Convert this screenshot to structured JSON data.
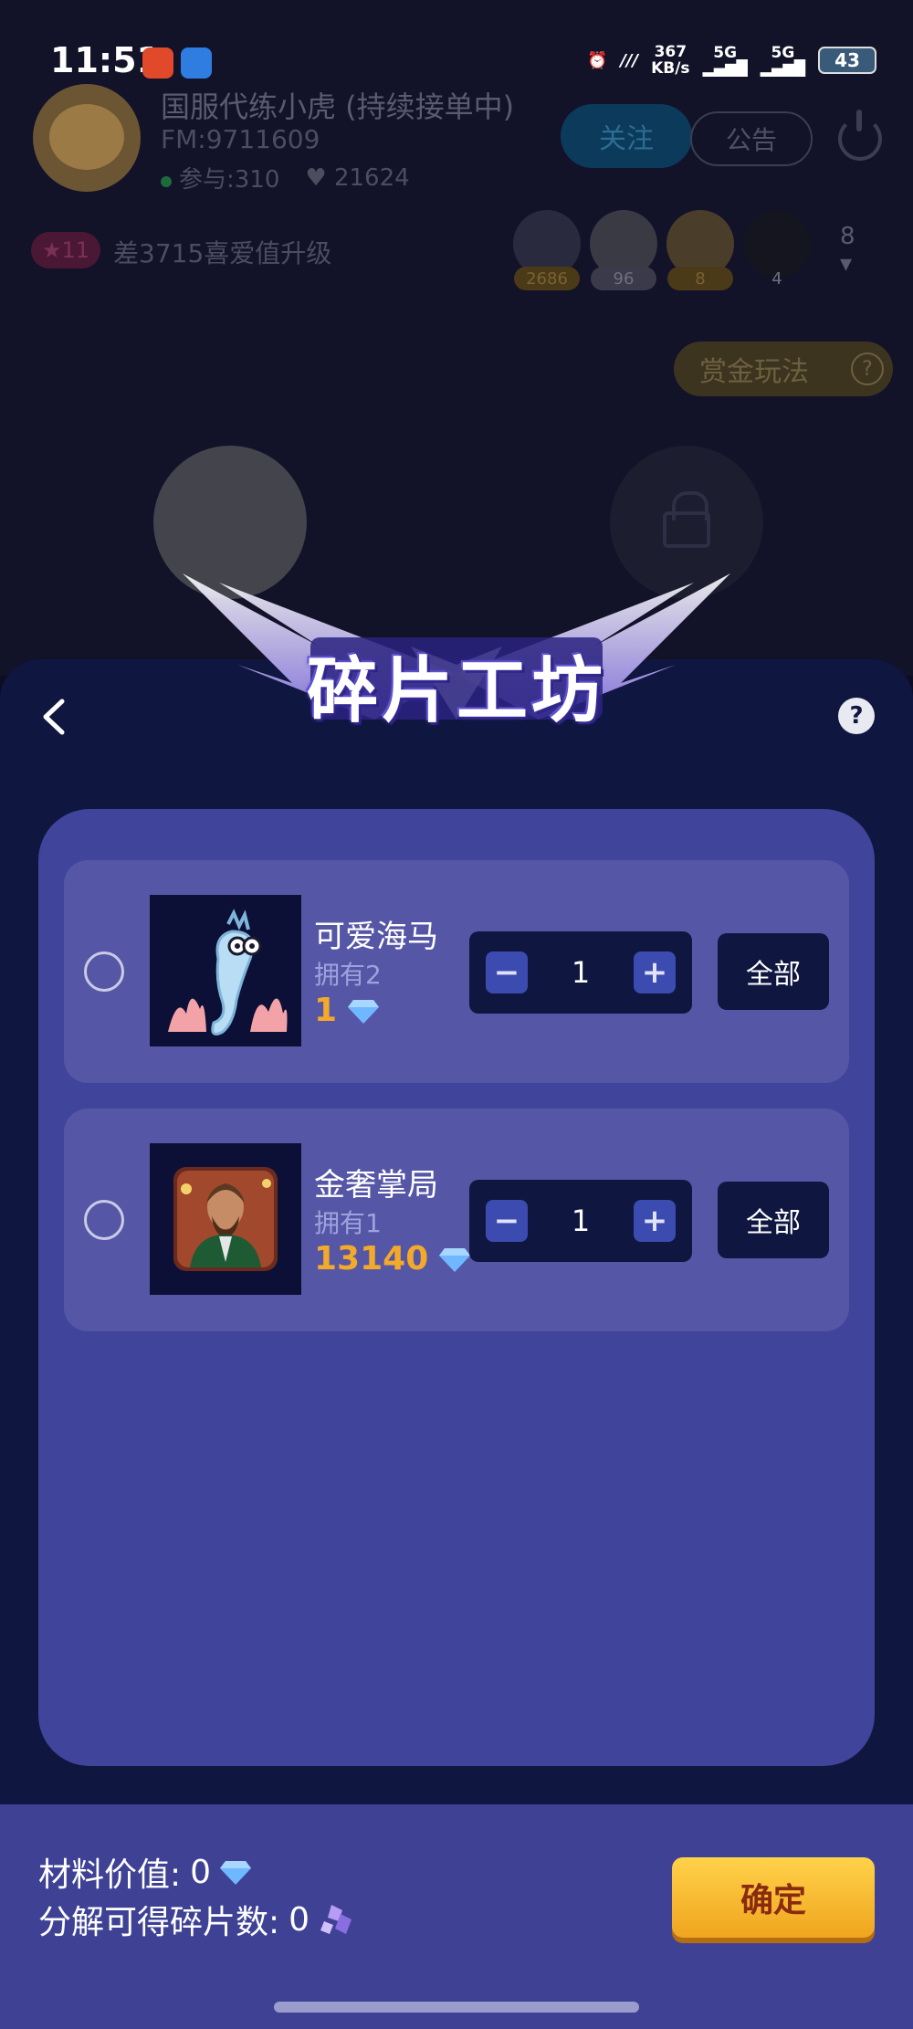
{
  "status_bar": {
    "time": "11:51",
    "net_speed": "367",
    "net_unit": "KB/s",
    "sim1": "5G",
    "sim2": "5G",
    "battery": "43"
  },
  "room": {
    "host_name": "国服代练小虎 (持续接单中)",
    "fm": "FM:9711609",
    "participants": "参与:310",
    "likes": "21624",
    "follow_label": "关注",
    "notice_label": "公告",
    "level": "11",
    "level_text": "差3715喜爱值升级",
    "audience_counts": [
      "2686",
      "96",
      "8",
      "4"
    ],
    "more_count": "8",
    "bounty_label": "赏金玩法"
  },
  "workshop": {
    "title": "碎片工坊",
    "help_label": "?",
    "items": [
      {
        "name": "可爱海马",
        "owned": "拥有2",
        "price": "1",
        "quantity": "1",
        "all_label": "全部",
        "thumb_icon": "seahorse-image"
      },
      {
        "name": "金奢掌局",
        "owned": "拥有1",
        "price": "13140",
        "quantity": "1",
        "all_label": "全部",
        "thumb_icon": "gentleman-image"
      }
    ],
    "material_value_label": "材料价值:",
    "material_value": "0",
    "fragments_label": "分解可得碎片数:",
    "fragments_value": "0",
    "confirm_label": "确定"
  },
  "colors": {
    "sheet_bg": "#0f1640",
    "panel_bg": "#40449a",
    "item_bg": "#5656a6",
    "price_gold": "#f3aa2a",
    "confirm_gold": "#f5b52b"
  }
}
